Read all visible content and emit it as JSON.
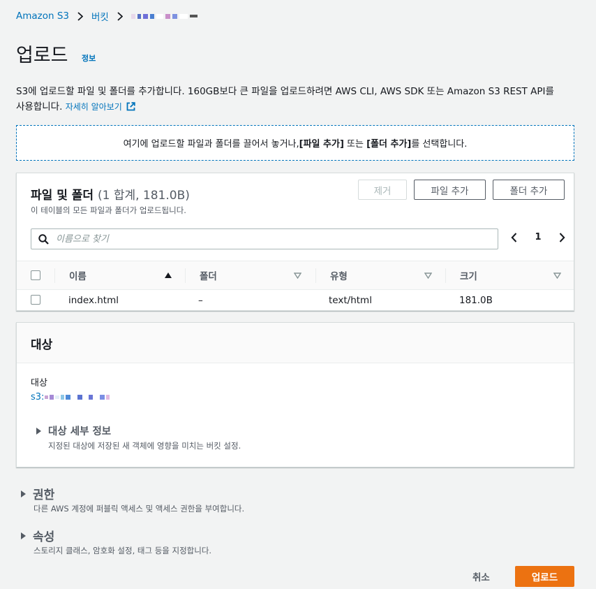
{
  "breadcrumb": {
    "items": [
      "Amazon S3",
      "버킷"
    ]
  },
  "page": {
    "title": "업로드",
    "info_link": "정보",
    "description": "S3에 업로드할 파일 및 폴더를 추가합니다. 160GB보다 큰 파일을 업로드하려면 AWS CLI, AWS SDK 또는 Amazon S3 REST API를",
    "description_line2": "사용합니다.",
    "learn_more": "자세히 알아보기"
  },
  "dropzone": {
    "text_before": "여기에 업로드할 파일과 폴더를 끌어서 놓거나, ",
    "add_files": "[파일 추가]",
    "text_mid": " 또는 ",
    "add_folder": "[폴더 추가]",
    "text_after": "를 선택합니다."
  },
  "files_panel": {
    "title": "파일 및 폴더",
    "count": "(1 합계, 181.0B)",
    "subtitle": "이 테이블의 모든 파일과 폴더가 업로드됩니다.",
    "remove_button": "제거",
    "add_files_button": "파일 추가",
    "add_folder_button": "폴더 추가",
    "search_placeholder": "이름으로 찾기",
    "page_number": "1",
    "columns": [
      "이름",
      "폴더",
      "유형",
      "크기"
    ],
    "rows": [
      {
        "name": "index.html",
        "folder": "–",
        "type": "text/html",
        "size": "181.0B"
      }
    ]
  },
  "destination": {
    "title": "대상",
    "label": "대상",
    "s3_prefix": "s3:",
    "details_title": "대상 세부 정보",
    "details_desc": "지정된 대상에 저장된 새 객체에 영향을 미치는 버킷 설정."
  },
  "permissions": {
    "title": "권한",
    "desc": "다른 AWS 계정에 퍼블릭 액세스 및 액세스 권한을 부여합니다."
  },
  "properties": {
    "title": "속성",
    "desc": "스토리지 클래스, 암호화 설정, 태그 등을 지정합니다."
  },
  "footer": {
    "cancel": "취소",
    "upload": "업로드"
  },
  "colors": {
    "link": "#0073bb",
    "primary": "#ec7211",
    "background": "#f2f3f3"
  }
}
